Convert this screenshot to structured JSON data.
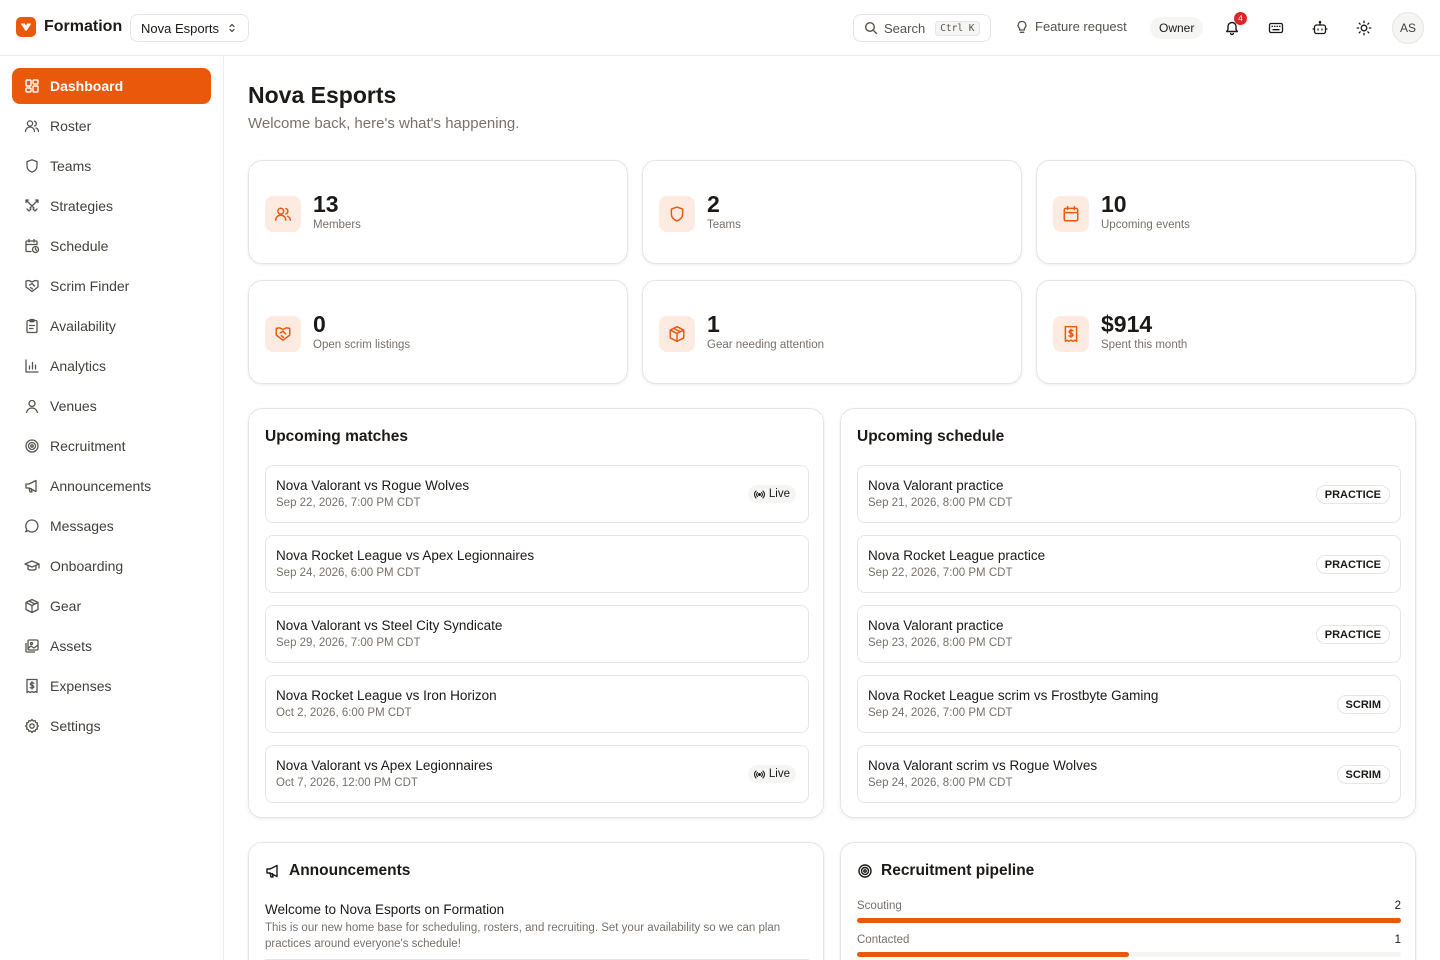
{
  "app": {
    "name": "Formation",
    "org": "Nova Esports"
  },
  "topbar": {
    "search_label": "Search",
    "search_shortcut": "Ctrl K",
    "feature_request": "Feature request",
    "role": "Owner",
    "notification_count": "4",
    "avatar_initials": "AS"
  },
  "sidebar": {
    "items": [
      {
        "label": "Dashboard",
        "icon": "dashboard-icon",
        "active": true
      },
      {
        "label": "Roster",
        "icon": "users-icon"
      },
      {
        "label": "Teams",
        "icon": "shield-icon"
      },
      {
        "label": "Strategies",
        "icon": "swords-icon"
      },
      {
        "label": "Schedule",
        "icon": "calendar-clock-icon"
      },
      {
        "label": "Scrim Finder",
        "icon": "handshake-icon"
      },
      {
        "label": "Availability",
        "icon": "clipboard-icon"
      },
      {
        "label": "Analytics",
        "icon": "bar-chart-icon"
      },
      {
        "label": "Venues",
        "icon": "location-icon"
      },
      {
        "label": "Recruitment",
        "icon": "target-icon"
      },
      {
        "label": "Announcements",
        "icon": "megaphone-icon"
      },
      {
        "label": "Messages",
        "icon": "message-icon"
      },
      {
        "label": "Onboarding",
        "icon": "graduation-cap-icon"
      },
      {
        "label": "Gear",
        "icon": "package-icon"
      },
      {
        "label": "Assets",
        "icon": "images-icon"
      },
      {
        "label": "Expenses",
        "icon": "receipt-icon"
      },
      {
        "label": "Settings",
        "icon": "gear-icon"
      }
    ]
  },
  "header": {
    "title": "Nova Esports",
    "subtitle": "Welcome back, here's what's happening."
  },
  "stats": [
    {
      "value": "13",
      "label": "Members",
      "icon": "users-icon"
    },
    {
      "value": "2",
      "label": "Teams",
      "icon": "shield-icon"
    },
    {
      "value": "10",
      "label": "Upcoming events",
      "icon": "calendar-icon"
    },
    {
      "value": "0",
      "label": "Open scrim listings",
      "icon": "handshake-icon"
    },
    {
      "value": "1",
      "label": "Gear needing attention",
      "icon": "package-icon"
    },
    {
      "value": "$914",
      "label": "Spent this month",
      "icon": "receipt-icon"
    }
  ],
  "matches": {
    "title": "Upcoming matches",
    "live_label": "Live",
    "items": [
      {
        "title": "Nova Valorant vs Rogue Wolves",
        "when": "Sep 22, 2026, 7:00 PM CDT",
        "live": true
      },
      {
        "title": "Nova Rocket League vs Apex Legionnaires",
        "when": "Sep 24, 2026, 6:00 PM CDT",
        "live": false
      },
      {
        "title": "Nova Valorant vs Steel City Syndicate",
        "when": "Sep 29, 2026, 7:00 PM CDT",
        "live": false
      },
      {
        "title": "Nova Rocket League vs Iron Horizon",
        "when": "Oct 2, 2026, 6:00 PM CDT",
        "live": false
      },
      {
        "title": "Nova Valorant vs Apex Legionnaires",
        "when": "Oct 7, 2026, 12:00 PM CDT",
        "live": true
      }
    ]
  },
  "schedule": {
    "title": "Upcoming schedule",
    "items": [
      {
        "title": "Nova Valorant practice",
        "when": "Sep 21, 2026, 8:00 PM CDT",
        "type": "PRACTICE"
      },
      {
        "title": "Nova Rocket League practice",
        "when": "Sep 22, 2026, 7:00 PM CDT",
        "type": "PRACTICE"
      },
      {
        "title": "Nova Valorant practice",
        "when": "Sep 23, 2026, 8:00 PM CDT",
        "type": "PRACTICE"
      },
      {
        "title": "Nova Rocket League scrim vs Frostbyte Gaming",
        "when": "Sep 24, 2026, 7:00 PM CDT",
        "type": "SCRIM"
      },
      {
        "title": "Nova Valorant scrim vs Rogue Wolves",
        "when": "Sep 24, 2026, 8:00 PM CDT",
        "type": "SCRIM"
      }
    ]
  },
  "announcements": {
    "title": "Announcements",
    "items": [
      {
        "title": "Welcome to Nova Esports on Formation",
        "body": "This is our new home base for scheduling, rosters, and recruiting. Set your availability so we can plan practices around everyone's schedule!"
      }
    ]
  },
  "recruitment": {
    "title": "Recruitment pipeline",
    "stages": [
      {
        "label": "Scouting",
        "count": "2",
        "fraction": 1.0
      },
      {
        "label": "Contacted",
        "count": "1",
        "fraction": 0.5
      }
    ]
  },
  "colors": {
    "accent": "#ea580c",
    "accent_soft": "#fdebe1",
    "notification": "#dc2626"
  }
}
